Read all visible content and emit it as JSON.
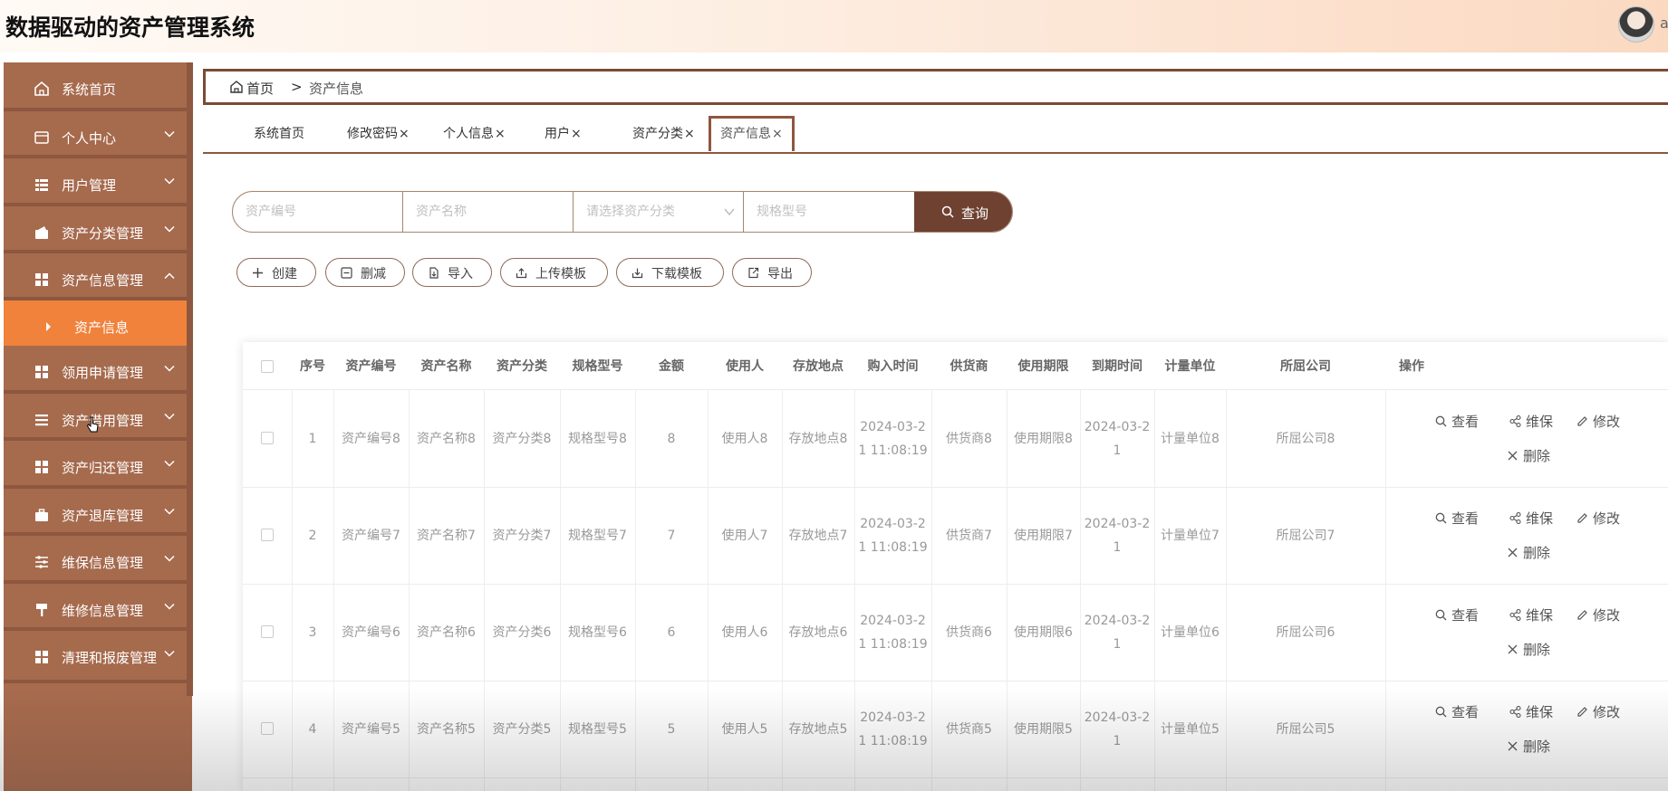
{
  "header": {
    "title": "数据驱动的资产管理系统",
    "user": "a"
  },
  "sidebar": {
    "items": [
      {
        "label": "系统首页",
        "icon": "home-icon",
        "arrow": "none"
      },
      {
        "label": "个人中心",
        "icon": "profile-icon",
        "arrow": "down"
      },
      {
        "label": "用户管理",
        "icon": "grid-icon",
        "arrow": "down"
      },
      {
        "label": "资产分类管理",
        "icon": "wallet-icon",
        "arrow": "down"
      },
      {
        "label": "资产信息管理",
        "icon": "dashboard-icon",
        "arrow": "up"
      },
      {
        "label": "资产信息",
        "icon": "caret-right-icon",
        "arrow": "none",
        "active": true
      },
      {
        "label": "领用申请管理",
        "icon": "dashboard-icon",
        "arrow": "down"
      },
      {
        "label": "资产借用管理",
        "icon": "list-icon",
        "arrow": "down"
      },
      {
        "label": "资产归还管理",
        "icon": "dashboard-icon",
        "arrow": "down"
      },
      {
        "label": "资产退库管理",
        "icon": "briefcase-icon",
        "arrow": "down"
      },
      {
        "label": "维保信息管理",
        "icon": "sliders-icon",
        "arrow": "down"
      },
      {
        "label": "维修信息管理",
        "icon": "hammer-icon",
        "arrow": "down"
      },
      {
        "label": "清理和报废管理",
        "icon": "dashboard-icon",
        "arrow": "down"
      }
    ]
  },
  "breadcrumb": {
    "home": "首页",
    "separator": ">",
    "current": "资产信息"
  },
  "tabs": [
    {
      "label": "系统首页",
      "closable": false
    },
    {
      "label": "修改密码",
      "closable": true
    },
    {
      "label": "个人信息",
      "closable": true
    },
    {
      "label": "用户",
      "closable": true
    },
    {
      "label": "资产分类",
      "closable": true
    },
    {
      "label": "资产信息",
      "closable": true,
      "active": true
    }
  ],
  "tab_close": "×",
  "search": {
    "asset_no_placeholder": "资产编号",
    "asset_name_placeholder": "资产名称",
    "category_placeholder": "请选择资产分类",
    "model_placeholder": "规格型号",
    "button": "查询"
  },
  "actions": {
    "create": "创建",
    "delete": "删减",
    "import": "导入",
    "upload_template": "上传模板",
    "download_template": "下载模板",
    "export": "导出"
  },
  "table": {
    "columns": [
      "序号",
      "资产编号",
      "资产名称",
      "资产分类",
      "规格型号",
      "金额",
      "使用人",
      "存放地点",
      "购入时间",
      "供货商",
      "使用期限",
      "到期时间",
      "计量单位",
      "所屈公司",
      "操作"
    ],
    "rows": [
      [
        "1",
        "资产编号8",
        "资产名称8",
        "资产分类8",
        "规格型号8",
        "8",
        "使用人8",
        "存放地点8",
        "2024-03-21 11:08:19",
        "供货商8",
        "使用期限8",
        "2024-03-21",
        "计量单位8",
        "所屈公司8"
      ],
      [
        "2",
        "资产编号7",
        "资产名称7",
        "资产分类7",
        "规格型号7",
        "7",
        "使用人7",
        "存放地点7",
        "2024-03-21 11:08:19",
        "供货商7",
        "使用期限7",
        "2024-03-21",
        "计量单位7",
        "所屈公司7"
      ],
      [
        "3",
        "资产编号6",
        "资产名称6",
        "资产分类6",
        "规格型号6",
        "6",
        "使用人6",
        "存放地点6",
        "2024-03-21 11:08:19",
        "供货商6",
        "使用期限6",
        "2024-03-21",
        "计量单位6",
        "所屈公司6"
      ],
      [
        "4",
        "资产编号5",
        "资产名称5",
        "资产分类5",
        "规格型号5",
        "5",
        "使用人5",
        "存放地点5",
        "2024-03-21 11:08:19",
        "供货商5",
        "使用期限5",
        "2024-03-21",
        "计量单位5",
        "所屈公司5"
      ]
    ],
    "row_actions": {
      "view": "查看",
      "maintain": "维保",
      "edit": "修改",
      "delete": "删除"
    }
  },
  "colors": {
    "sidebar_bg": "#a66a4d",
    "sidebar_active": "#f0823c",
    "search_button": "#6e4130",
    "border_brown": "#8e573f"
  }
}
